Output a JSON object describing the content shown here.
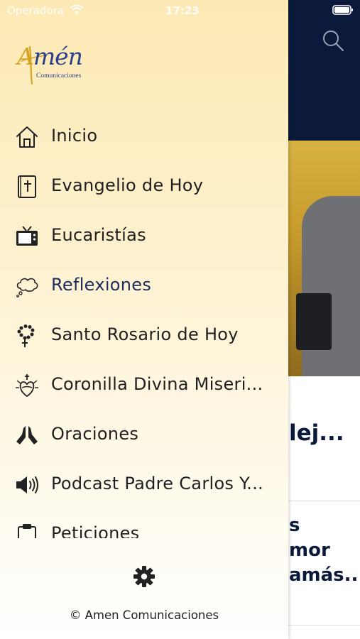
{
  "status_bar": {
    "carrier": "Operadora",
    "time": "17:23"
  },
  "logo": {
    "title_first": "A",
    "title_rest": "mén",
    "subtitle": "Comunicaciones"
  },
  "menu": {
    "items": [
      {
        "label": "Inicio",
        "icon": "home-icon"
      },
      {
        "label": "Evangelio de Hoy",
        "icon": "bible-icon"
      },
      {
        "label": "Eucaristías",
        "icon": "tv-icon"
      },
      {
        "label": "Reflexiones",
        "icon": "thought-bubble-icon"
      },
      {
        "label": "Santo Rosario de Hoy",
        "icon": "rosary-icon"
      },
      {
        "label": "Coronilla  Divina Miseri...",
        "icon": "sacred-heart-icon"
      },
      {
        "label": "Oraciones",
        "icon": "praying-hands-icon"
      },
      {
        "label": "Podcast Padre Carlos Y...",
        "icon": "speaker-icon"
      },
      {
        "label": "Peticiones",
        "icon": "clipboard-icon"
      }
    ],
    "active_index": 3
  },
  "footer": {
    "settings_icon": "gear-icon",
    "copyright": "© Amen Comunicaciones"
  },
  "background": {
    "title_fragment": "lej...",
    "text_fragment": "s\nmor\namás..."
  },
  "colors": {
    "header_navy": "#0b1a3a",
    "logo_blue": "#2c3f8c",
    "logo_gold": "#d7a322",
    "drawer_top": "#fde9b4"
  }
}
